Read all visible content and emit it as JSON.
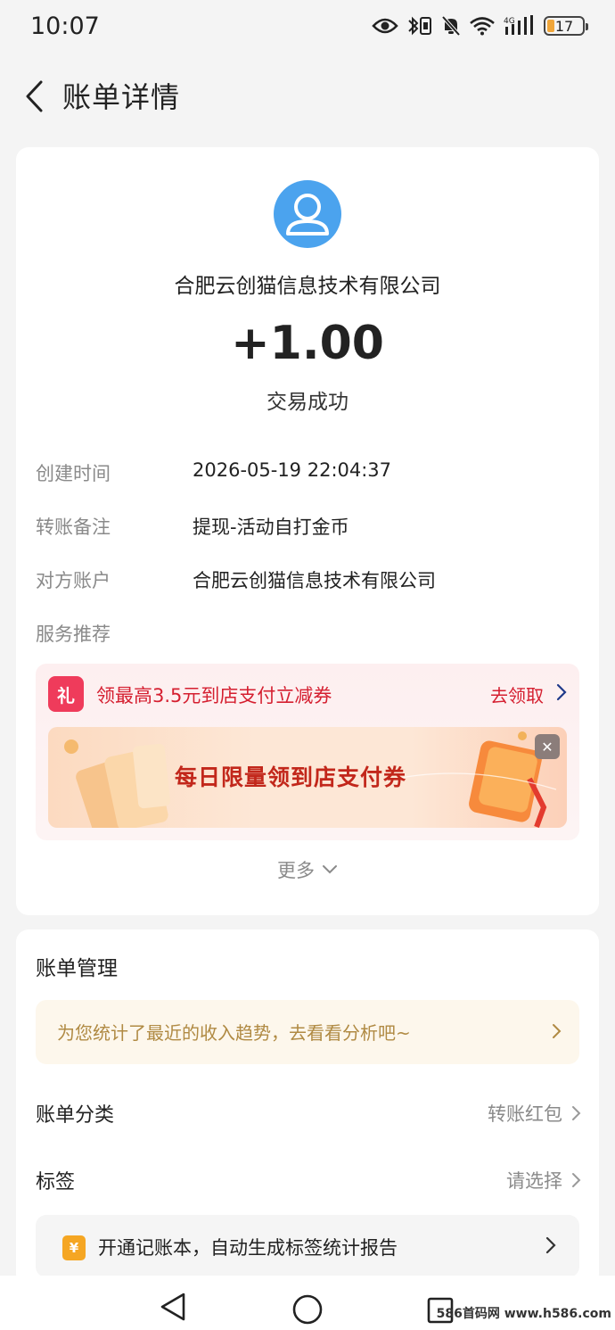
{
  "status_bar": {
    "time": "10:07",
    "network": "4G",
    "battery": "17"
  },
  "header": {
    "title": "账单详情"
  },
  "transaction": {
    "payee": "合肥云创猫信息技术有限公司",
    "amount": "+1.00",
    "status": "交易成功"
  },
  "details": [
    {
      "label": "创建时间",
      "value": "2026-05-19 22:04:37"
    },
    {
      "label": "转账备注",
      "value": "提现-活动自打金币"
    },
    {
      "label": "对方账户",
      "value": "合肥云创猫信息技术有限公司"
    },
    {
      "label": "服务推荐",
      "value": ""
    }
  ],
  "promo": {
    "icon_text": "礼",
    "title": "领最高3.5元到店支付立减券",
    "claim_label": "去领取",
    "banner_text": "每日限量领到店支付券"
  },
  "more_label": "更多",
  "bill_management": {
    "title": "账单管理",
    "insight_text": "为您统计了最近的收入趋势，去看看分析吧~",
    "rows": [
      {
        "label": "账单分类",
        "value": "转账红包"
      },
      {
        "label": "标签",
        "value": "请选择"
      }
    ],
    "ledger_icon": "¥",
    "ledger_text": "开通记账本，自动生成标签统计报告"
  },
  "watermark": "586首码网 www.h586.com",
  "colors": {
    "accent_red": "#d51f30",
    "avatar_blue": "#4ba3ee",
    "insight_gold": "#b08a43"
  }
}
